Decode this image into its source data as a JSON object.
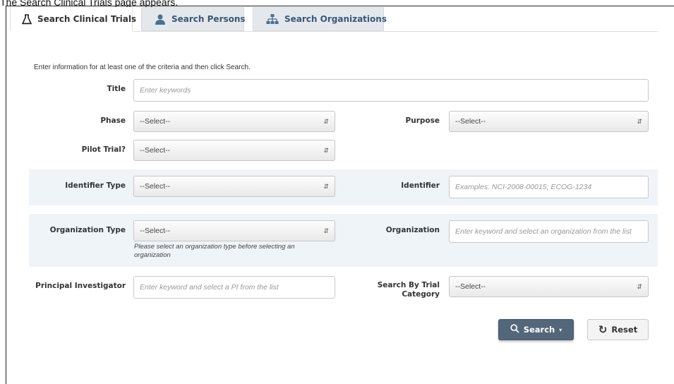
{
  "caption": "The Search Clinical Trials page appears.",
  "tabs": [
    {
      "label": "Search Clinical Trials",
      "icon": "flask-icon",
      "active": true
    },
    {
      "label": "Search Persons",
      "icon": "person-icon",
      "active": false
    },
    {
      "label": "Search Organizations",
      "icon": "org-chart-icon",
      "active": false
    }
  ],
  "intro": "Enter information for at least one of the criteria and then click Search.",
  "form": {
    "title": {
      "label": "Title",
      "placeholder": "Enter keywords"
    },
    "phase": {
      "label": "Phase",
      "value": "--Select--"
    },
    "purpose": {
      "label": "Purpose",
      "value": "--Select--"
    },
    "pilot": {
      "label": "Pilot Trial?",
      "value": "--Select--"
    },
    "identifier_type": {
      "label": "Identifier Type",
      "value": "--Select--"
    },
    "identifier": {
      "label": "Identifier",
      "placeholder": "Examples: NCI-2008-00015; ECOG-1234"
    },
    "org_type": {
      "label": "Organization Type",
      "value": "--Select--",
      "help": "Please select an organization type before selecting an organization"
    },
    "organization": {
      "label": "Organization",
      "placeholder": "Enter keyword and select an organization from the list"
    },
    "pi": {
      "label": "Principal Investigator",
      "placeholder": "Enter keyword and select a PI from the list"
    },
    "trial_category": {
      "label": "Search By Trial Category",
      "value": "--Select--"
    }
  },
  "buttons": {
    "search": "Search",
    "reset": "Reset"
  },
  "colors": {
    "band": "#eff4f9",
    "search_button": "#53667a",
    "tab_inactive": "#e4e8ed",
    "tab_icon": "#4a6f92"
  }
}
